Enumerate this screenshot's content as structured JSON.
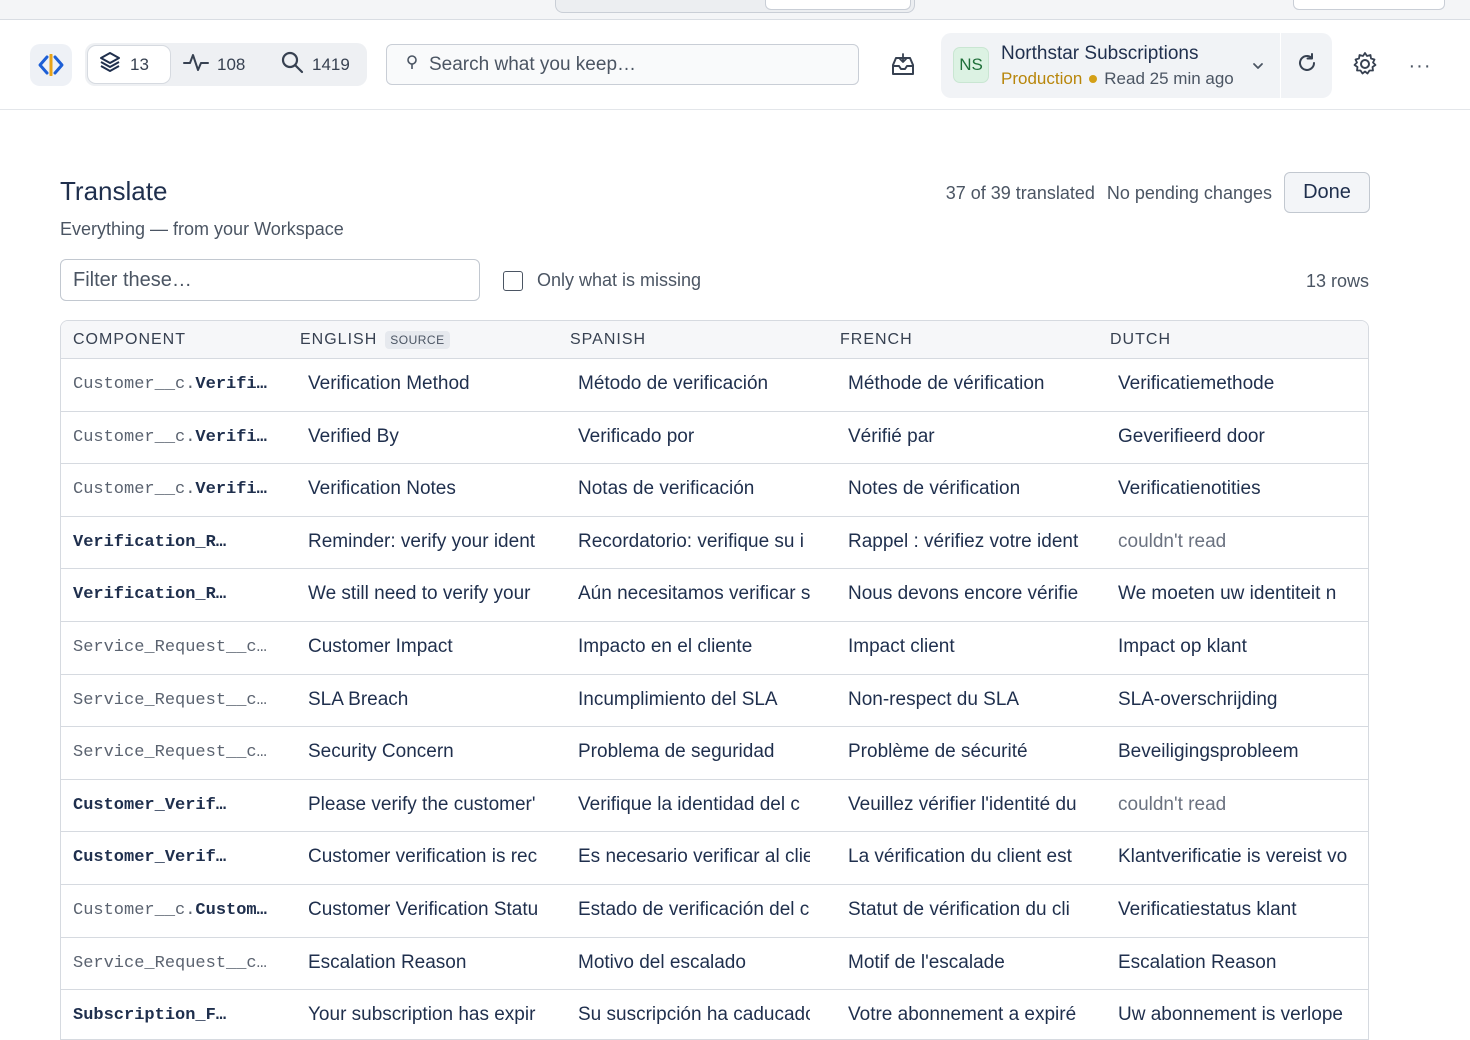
{
  "header": {
    "counters": [
      {
        "icon": "layers-icon",
        "value": "13"
      },
      {
        "icon": "activity-icon",
        "value": "108"
      },
      {
        "icon": "search-icon",
        "value": "1419"
      }
    ],
    "search_placeholder": "Search what you keep…",
    "org": {
      "avatar": "NS",
      "name": "Northstar Subscriptions",
      "environment": "Production",
      "read_status": "Read 25 min ago"
    }
  },
  "page": {
    "title": "Translate",
    "subtitle": "Everything — from your Workspace",
    "progress_text": "37 of 39 translated",
    "pending_text": "No pending changes",
    "done_label": "Done",
    "filter_placeholder": "Filter these…",
    "only_missing_label": "Only what is missing",
    "row_count": "13 rows"
  },
  "table": {
    "headers": {
      "component": "COMPONENT",
      "english": "ENGLISH",
      "source_badge": "SOURCE",
      "spanish": "SPANISH",
      "french": "FRENCH",
      "dutch": "DUTCH"
    },
    "rows": [
      {
        "comp_prefix": "Customer__c.",
        "comp_main": "Verifi…",
        "en": "Verification Method",
        "es": "Método de verificación",
        "fr": "Méthode de vérification",
        "nl": "Verificatiemethode"
      },
      {
        "comp_prefix": "Customer__c.",
        "comp_main": "Verifi…",
        "en": "Verified By",
        "es": "Verificado por",
        "fr": "Vérifié par",
        "nl": "Geverifieerd door"
      },
      {
        "comp_prefix": "Customer__c.",
        "comp_main": "Verifi…",
        "en": "Verification Notes",
        "es": "Notas de verificación",
        "fr": "Notes de vérification",
        "nl": "Verificatienotities"
      },
      {
        "comp_prefix": "",
        "comp_main": "Verification_R…",
        "en": "Reminder: verify your ident",
        "es": "Recordatorio: verifique su i",
        "fr": "Rappel : vérifiez votre ident",
        "nl": "couldn't read",
        "nl_missing": true
      },
      {
        "comp_prefix": "",
        "comp_main": "Verification_R…",
        "en": "We still need to verify your",
        "es": "Aún necesitamos verificar s",
        "fr": "Nous devons encore vérifie",
        "nl": "We moeten uw identiteit n"
      },
      {
        "comp_prefix": "Service_Request__c…",
        "comp_main": "",
        "en": "Customer Impact",
        "es": "Impacto en el cliente",
        "fr": "Impact client",
        "nl": "Impact op klant"
      },
      {
        "comp_prefix": "Service_Request__c…",
        "comp_main": "",
        "en": "SLA Breach",
        "es": "Incumplimiento del SLA",
        "fr": "Non-respect du SLA",
        "nl": "SLA-overschrijding"
      },
      {
        "comp_prefix": "Service_Request__c…",
        "comp_main": "",
        "en": "Security Concern",
        "es": "Problema de seguridad",
        "fr": "Problème de sécurité",
        "nl": "Beveiligingsprobleem"
      },
      {
        "comp_prefix": "",
        "comp_main": "Customer_Verif…",
        "en": "Please verify the customer'",
        "es": "Verifique la identidad del c",
        "fr": "Veuillez vérifier l'identité du",
        "nl": "couldn't read",
        "nl_missing": true
      },
      {
        "comp_prefix": "",
        "comp_main": "Customer_Verif…",
        "en": "Customer verification is rec",
        "es": "Es necesario verificar al clie",
        "fr": "La vérification du client est",
        "nl": "Klantverificatie is vereist vo"
      },
      {
        "comp_prefix": "Customer__c.",
        "comp_main": "Custom…",
        "en": "Customer Verification Statu",
        "es": "Estado de verificación del c",
        "fr": "Statut de vérification du cli",
        "nl": "Verificatiestatus klant"
      },
      {
        "comp_prefix": "Service_Request__c…",
        "comp_main": "",
        "en": "Escalation Reason",
        "es": "Motivo del escalado",
        "fr": "Motif de l'escalade",
        "nl": "Escalation Reason"
      },
      {
        "comp_prefix": "",
        "comp_main": "Subscription_F…",
        "en": "Your subscription has expir",
        "es": "Su suscripción ha caducado",
        "fr": "Votre abonnement a expiré",
        "nl": "Uw abonnement is verlope"
      }
    ]
  }
}
